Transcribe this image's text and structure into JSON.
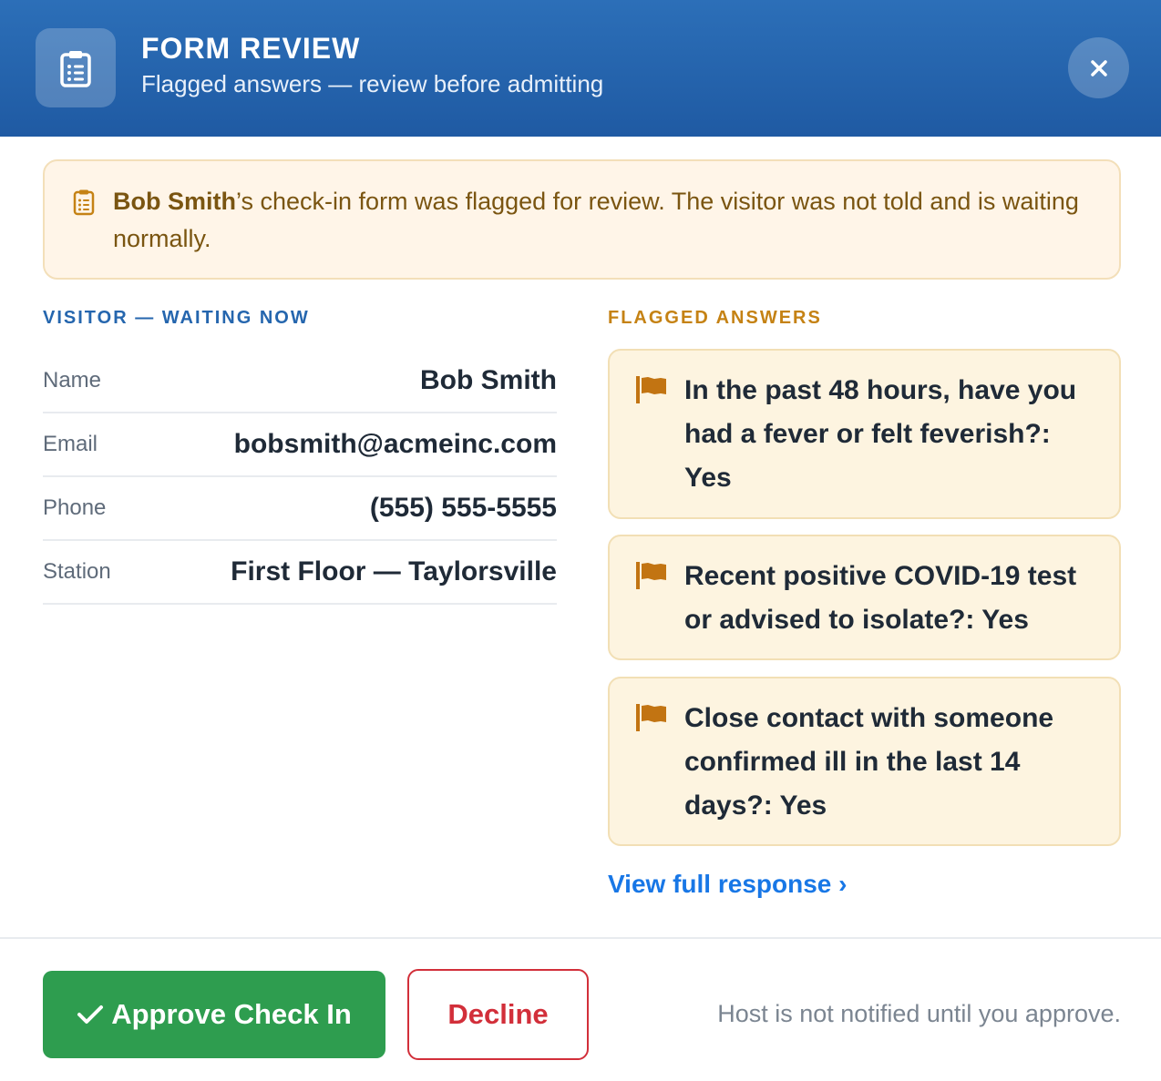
{
  "header": {
    "title": "FORM REVIEW",
    "subtitle": "Flagged answers — review before admitting",
    "icon": "clipboard-icon",
    "close_icon": "close-icon"
  },
  "alert": {
    "visitor_name": "Bob Smith",
    "message": "’s check-in form was flagged for review. The visitor was not told and is waiting normally.",
    "icon": "clipboard-icon"
  },
  "visitor_section": {
    "label": "VISITOR — WAITING NOW",
    "rows": [
      {
        "key": "Name",
        "value": "Bob Smith"
      },
      {
        "key": "Email",
        "value": "bobsmith@acmeinc.com"
      },
      {
        "key": "Phone",
        "value": "(555) 555-5555"
      },
      {
        "key": "Station",
        "value": "First Floor — Taylorsville"
      }
    ]
  },
  "flagged_section": {
    "label": "FLAGGED ANSWERS",
    "answers": [
      {
        "text": "In the past 48 hours, have you had a fever or felt feverish?: Yes"
      },
      {
        "text": "Recent positive COVID-19 test or advised to isolate?: Yes"
      },
      {
        "text": "Close contact with someone confirmed ill in the last 14 days?: Yes"
      }
    ],
    "view_link": "View full response ›"
  },
  "footer": {
    "approve_label": "Approve Check In",
    "decline_label": "Decline",
    "note": "Host is not notified until you approve."
  },
  "colors": {
    "header": "#1f5aa3",
    "approve": "#2e9d4f",
    "decline": "#d22f3a",
    "flag": "#c27412",
    "link": "#1877e6"
  }
}
